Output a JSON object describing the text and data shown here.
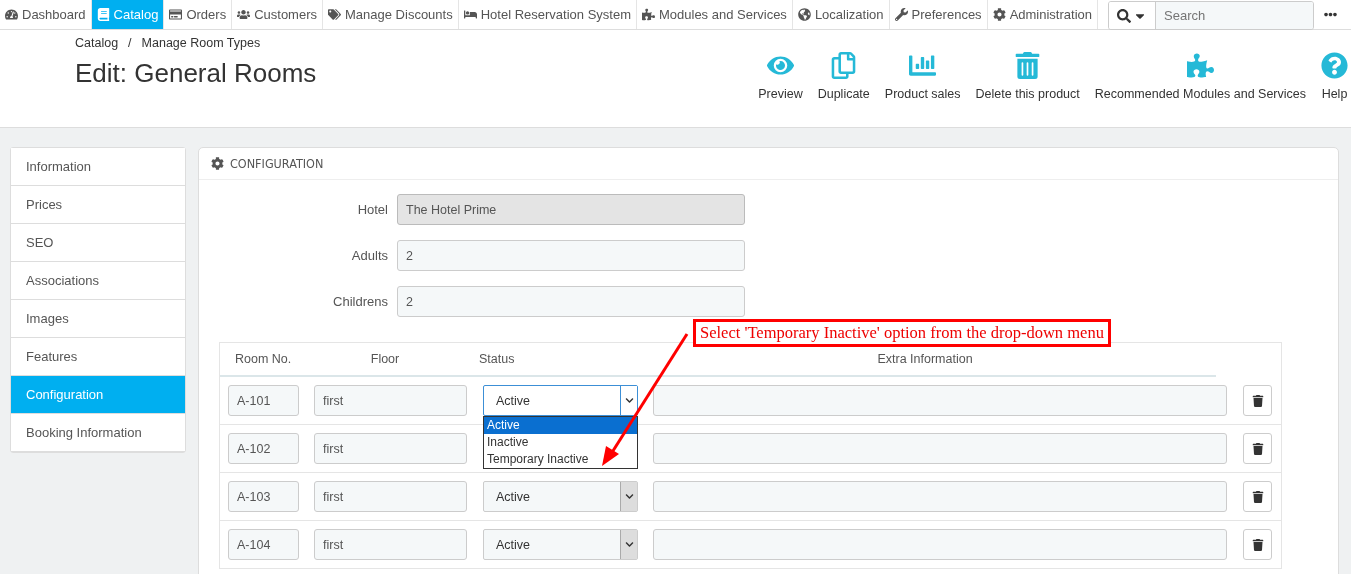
{
  "nav": {
    "items": [
      {
        "label": "Dashboard",
        "selected": false
      },
      {
        "label": "Catalog",
        "selected": true
      },
      {
        "label": "Orders",
        "selected": false
      },
      {
        "label": "Customers",
        "selected": false
      },
      {
        "label": "Manage Discounts",
        "selected": false
      },
      {
        "label": "Hotel Reservation System",
        "selected": false
      },
      {
        "label": "Modules and Services",
        "selected": false
      },
      {
        "label": "Localization",
        "selected": false
      },
      {
        "label": "Preferences",
        "selected": false
      },
      {
        "label": "Administration",
        "selected": false
      }
    ],
    "search": {
      "placeholder": "Search"
    }
  },
  "header": {
    "breadcrumb": [
      "Catalog",
      "Manage Room Types"
    ],
    "breadcrumb_separator": "/",
    "title": "Edit: General Rooms",
    "actions": [
      "Preview",
      "Duplicate",
      "Product sales",
      "Delete this product",
      "Recommended Modules and Services",
      "Help"
    ]
  },
  "sidebar": {
    "items": [
      {
        "label": "Information",
        "selected": false
      },
      {
        "label": "Prices",
        "selected": false
      },
      {
        "label": "SEO",
        "selected": false
      },
      {
        "label": "Associations",
        "selected": false
      },
      {
        "label": "Images",
        "selected": false
      },
      {
        "label": "Features",
        "selected": false
      },
      {
        "label": "Configuration",
        "selected": true
      },
      {
        "label": "Booking Information",
        "selected": false
      }
    ]
  },
  "panel": {
    "title": "CONFIGURATION",
    "fields": [
      {
        "label": "Hotel",
        "value": "The Hotel Prime",
        "disabled": true
      },
      {
        "label": "Adults",
        "value": "2",
        "disabled": false
      },
      {
        "label": "Childrens",
        "value": "2",
        "disabled": false
      }
    ],
    "table": {
      "columns": [
        "Room No.",
        "Floor",
        "Status",
        "Extra Information"
      ],
      "rows": [
        {
          "room": "A-101",
          "floor": "first",
          "status": "Active",
          "open": true,
          "options": [
            {
              "label": "Active",
              "selected": true
            },
            {
              "label": "Inactive",
              "selected": false
            },
            {
              "label": "Temporary Inactive",
              "selected": false
            }
          ]
        },
        {
          "room": "A-102",
          "floor": "first"
        },
        {
          "room": "A-103",
          "floor": "first",
          "status": "Active",
          "open": false
        },
        {
          "room": "A-104",
          "floor": "first",
          "status": "Active",
          "open": false
        }
      ]
    }
  },
  "annotation": {
    "text": "Select 'Temporary Inactive' option from the drop-down menu"
  }
}
